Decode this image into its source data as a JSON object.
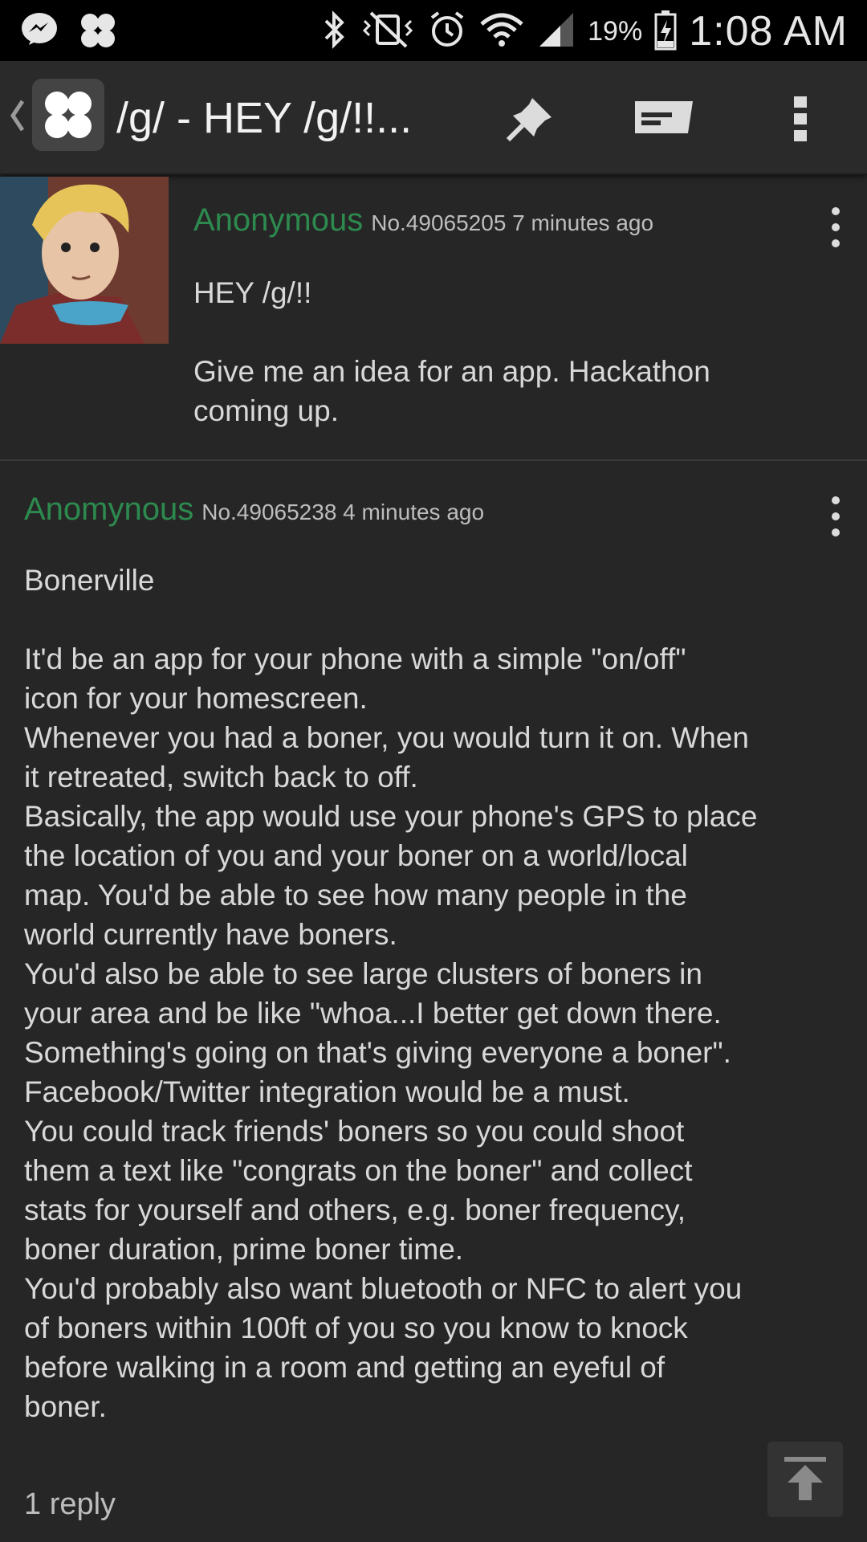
{
  "status_bar": {
    "battery_percent": "19%",
    "time": "1:08 AM",
    "icons": [
      "messenger-icon",
      "clover-icon",
      "bluetooth-icon",
      "vibrate-icon",
      "alarm-icon",
      "wifi-icon",
      "signal-icon",
      "battery-icon"
    ]
  },
  "app_bar": {
    "title": "/g/ - HEY /g/!!...",
    "icons": [
      "back-chevron-icon",
      "clover-logo-icon",
      "pin-icon",
      "reply-icon",
      "more-vert-icon"
    ]
  },
  "posts": [
    {
      "name": "Anonymous",
      "meta": "No.49065205 7 minutes ago",
      "comment": "HEY /g/!!\n\nGive me an idea for an app. Hackathon\ncoming up."
    },
    {
      "name": "Anomynous",
      "meta": "No.49065238 4 minutes ago",
      "comment": "Bonerville\n\nIt'd be an app for your phone with a simple \"on/off\"\nicon for your homescreen.\nWhenever you had a boner, you would turn it on. When\nit retreated, switch back to off.\nBasically, the app would use your phone's GPS to place\nthe location of you and your boner on a world/local\nmap. You'd be able to see how many people in the\nworld currently have boners.\nYou'd also be able to see large clusters of boners in\nyour area and be like \"whoa...I better get down there.\nSomething's going on that's giving everyone a boner\".\nFacebook/Twitter integration would be a must.\nYou could track friends' boners so you could shoot\nthem a text like \"congrats on the boner\" and collect\nstats for yourself and others, e.g. boner frequency,\nboner duration, prime boner time.\nYou'd probably also want bluetooth or NFC to alert you\nof boners within 100ft of you so you know to knock\nbefore walking in a room and getting an eyeful of\nboner.",
      "replies": "1 reply"
    }
  ],
  "colors": {
    "name_green": "#2d8a4e",
    "background": "#262626",
    "appbar": "#2a2a2a"
  }
}
